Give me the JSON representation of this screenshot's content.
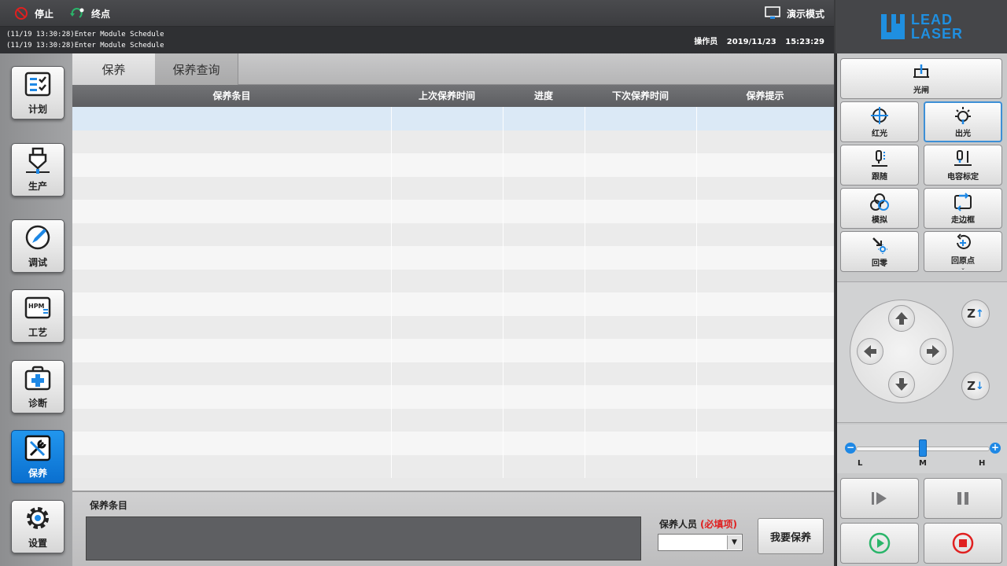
{
  "topbar": {
    "stop_label": "停止",
    "end_label": "终点",
    "demo_label": "演示模式"
  },
  "log": {
    "line1": "(11/19 13:30:28)Enter Module Schedule",
    "line2": "(11/19 13:30:28)Enter Module Schedule",
    "operator_label": "操作员",
    "date": "2019/11/23",
    "time": "15:23:29"
  },
  "logo": {
    "line1": "LEAD",
    "line2": "LASER"
  },
  "sidebar": {
    "items": [
      {
        "label": "计划",
        "icon": "plan-icon"
      },
      {
        "label": "生产",
        "icon": "production-icon"
      },
      {
        "label": "调试",
        "icon": "debug-icon"
      },
      {
        "label": "工艺",
        "icon": "process-icon",
        "icon_text": "HPM"
      },
      {
        "label": "诊断",
        "icon": "diagnose-icon"
      },
      {
        "label": "保养",
        "icon": "maintenance-icon",
        "active": true
      },
      {
        "label": "设置",
        "icon": "settings-icon"
      }
    ]
  },
  "tabs": [
    {
      "label": "保养",
      "active": true
    },
    {
      "label": "保养查询",
      "active": false
    }
  ],
  "table": {
    "columns": [
      "保养条目",
      "上次保养时间",
      "进度",
      "下次保养时间",
      "保养提示"
    ],
    "row_count": 16
  },
  "bottom": {
    "item_label": "保养条目",
    "person_label": "保养人员",
    "required_label": "(必填项)",
    "person_value": "",
    "submit_label": "我要保养"
  },
  "right_panel": {
    "shutter_label": "光闸",
    "buttons": [
      {
        "label": "红光",
        "icon": "red-light-icon"
      },
      {
        "label": "出光",
        "icon": "laser-out-icon",
        "selected": true
      },
      {
        "label": "跟随",
        "icon": "follow-icon"
      },
      {
        "label": "电容标定",
        "icon": "capacitance-calibrate-icon"
      },
      {
        "label": "模拟",
        "icon": "simulate-icon"
      },
      {
        "label": "走边框",
        "icon": "frame-icon"
      },
      {
        "label": "回零",
        "icon": "return-zero-icon"
      },
      {
        "label": "回原点",
        "icon": "return-origin-icon"
      }
    ],
    "z_up_label": "Z",
    "z_down_label": "Z",
    "speed": {
      "low": "L",
      "mid": "M",
      "high": "H",
      "level": 0.5
    }
  },
  "colors": {
    "accent": "#1e88e5",
    "sidebar_active": "#1677d6",
    "stop_red": "#e02020",
    "end_green": "#2ab56a"
  }
}
